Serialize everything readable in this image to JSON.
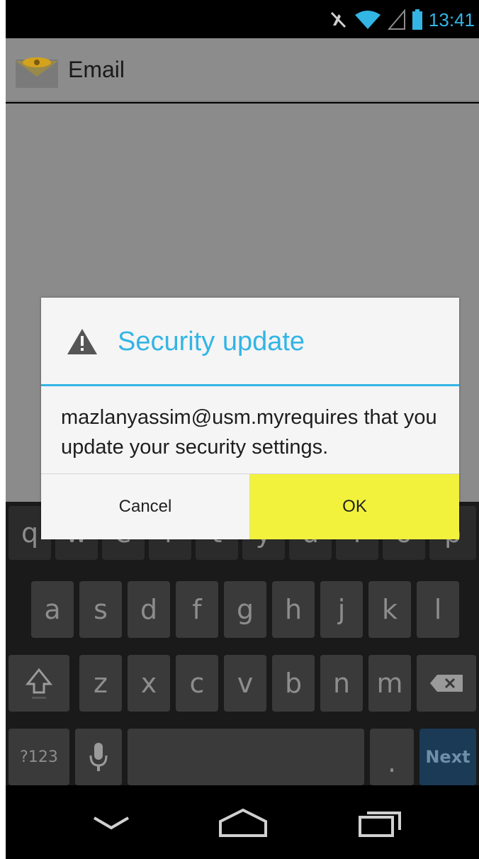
{
  "status_bar": {
    "time": "13:41"
  },
  "action_bar": {
    "title": "Email"
  },
  "dialog": {
    "title": "Security update",
    "message": "mazlanyassim@usm.myrequires that you update your security settings.",
    "cancel_label": "Cancel",
    "ok_label": "OK",
    "accent_color": "#33b5e5",
    "ok_highlight_color": "#f2f23c"
  },
  "keyboard": {
    "row1": [
      "q",
      "w",
      "e",
      "r",
      "t",
      "y",
      "u",
      "i",
      "o",
      "p"
    ],
    "row2": [
      "a",
      "s",
      "d",
      "f",
      "g",
      "h",
      "j",
      "k",
      "l"
    ],
    "row3": [
      "z",
      "x",
      "c",
      "v",
      "b",
      "n",
      "m"
    ],
    "symbols_label": "?123",
    "dot_label": ".",
    "action_label": "Next"
  },
  "icons": [
    "mute-icon",
    "wifi-icon",
    "signal-icon",
    "battery-icon",
    "email-app-icon",
    "warning-icon",
    "shift-icon",
    "backspace-icon",
    "mic-icon",
    "back-icon",
    "home-icon",
    "recents-icon"
  ]
}
